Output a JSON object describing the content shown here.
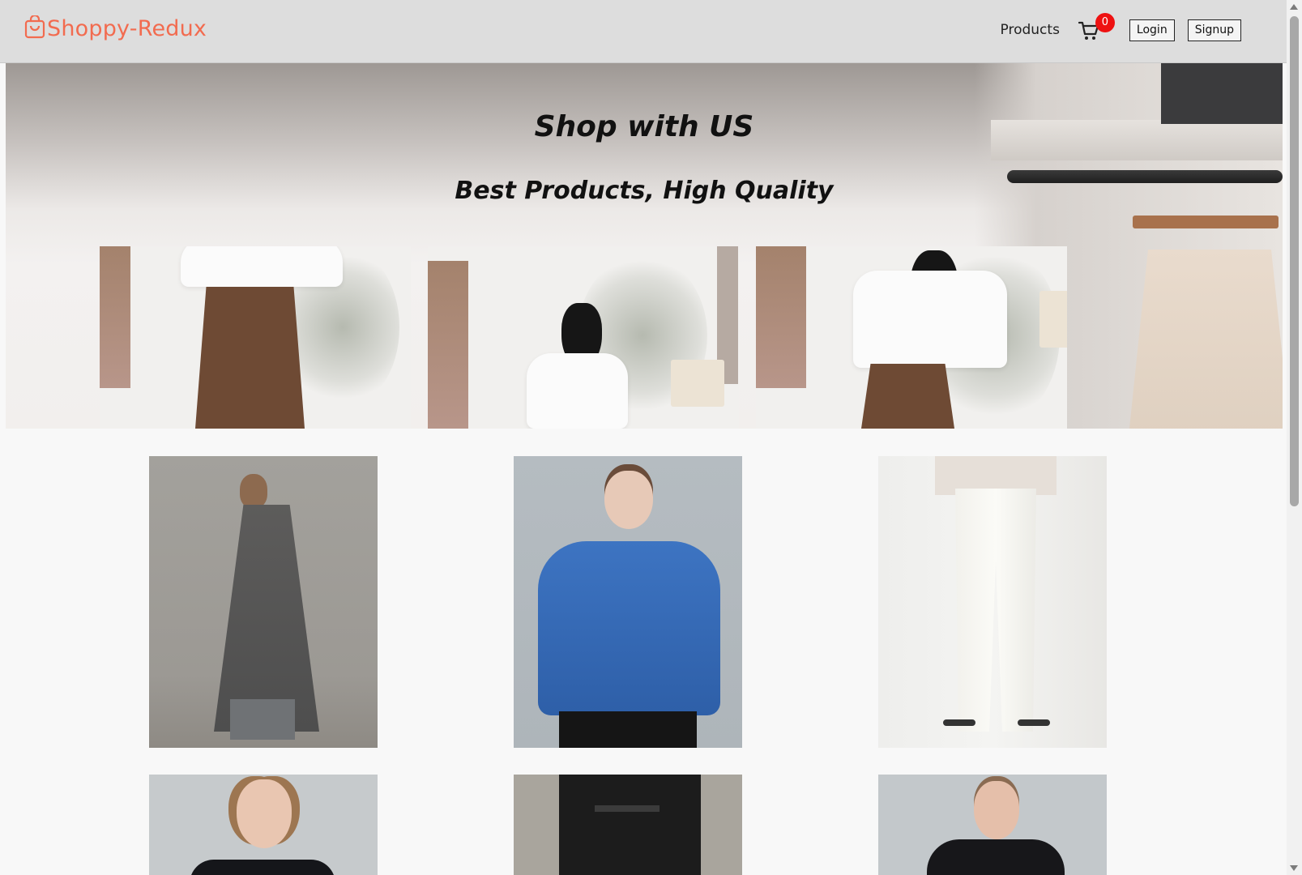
{
  "brand": {
    "name": "Shoppy-Redux",
    "icon": "shopping-bag-icon",
    "color": "#f26b4f"
  },
  "nav": {
    "products_label": "Products",
    "cart_icon": "cart-icon",
    "cart_count": "0",
    "login_label": "Login",
    "signup_label": "Signup"
  },
  "hero": {
    "title": "Shop with US",
    "subtitle": "Best Products, High Quality"
  },
  "colors": {
    "badge": "#ee1111",
    "navbar_bg": "#dddddd",
    "page_bg": "#f8f8f8"
  }
}
